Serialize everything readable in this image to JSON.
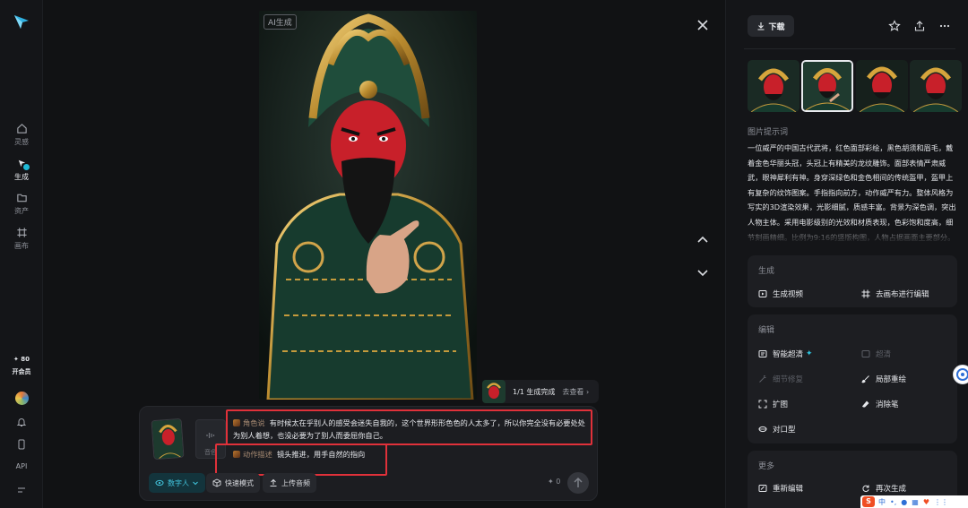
{
  "rail": {
    "items": [
      {
        "label": "灵感",
        "icon": "home-icon"
      },
      {
        "label": "生成",
        "icon": "generate-icon"
      },
      {
        "label": "资产",
        "icon": "folder-icon"
      },
      {
        "label": "画布",
        "icon": "canvas-icon"
      }
    ],
    "vip_points": "✦ 80",
    "vip_label": "开会员",
    "api_label": "API"
  },
  "viewer": {
    "ai_tag": "AI生成",
    "status_text": "1/1 生成完成",
    "status_link": "去查看 ›"
  },
  "composer": {
    "audio_label": "音色",
    "line1_tag": "角色说",
    "line1_text": "有时候太在乎别人的感受会迷失自我的，这个世界形形色色的人太多了，所以你完全没有必要处处为别人着想，也没必要为了别人而委屈你自己。",
    "line2_tag": "动作描述",
    "line2_text": "镜头推进，用手自然的指向",
    "mode_label": "数字人",
    "fast_label": "快速模式",
    "upload_label": "上传音频",
    "credits": "0"
  },
  "panel": {
    "download_label": "下载",
    "prompt_title": "图片提示词",
    "prompt_text": "一位威严的中国古代武将，红色面部彩绘，黑色胡须和眉毛，戴着金色华丽头冠，头冠上有精美的龙纹雕饰。面部表情严肃威武，眼神犀利有神。身穿深绿色和金色相间的传统盔甲，盔甲上有复杂的纹饰图案。手指指向前方，动作威严有力。整体风格为写实的3D渲染效果，光影细腻，质感丰富。背景为深色调，突出人物主体。采用电影级别的光效和材质表现，色彩饱和度高，细节刻画精细。比例为9:16的竖版构图，人物占据画面主要部分。",
    "generate_card": {
      "title": "生成",
      "actions": [
        "生成视频",
        "去画布进行编辑"
      ]
    },
    "edit_card": {
      "title": "编辑",
      "actions": [
        "智能超清",
        "超清",
        "细节修复",
        "局部重绘",
        "扩图",
        "消除笔",
        "对口型"
      ]
    },
    "more_card": {
      "title": "更多",
      "actions": [
        "重新编辑",
        "再次生成"
      ]
    }
  },
  "ime": {
    "brand": "S",
    "label": "中"
  }
}
